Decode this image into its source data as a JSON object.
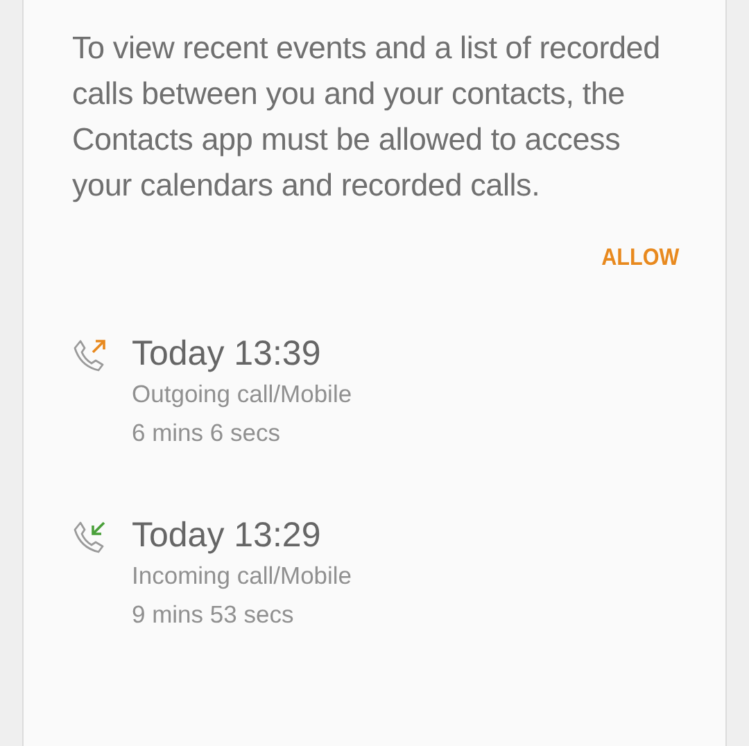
{
  "permission": {
    "message": "To view recent events and a list of recorded calls between you and your contacts, the Contacts app must be allowed to access your calendars and recorded calls.",
    "button": "ALLOW"
  },
  "calls": [
    {
      "kind": "outgoing",
      "time": "Today 13:39",
      "type": "Outgoing call/Mobile",
      "duration": "6 mins 6 secs"
    },
    {
      "kind": "incoming",
      "time": "Today 13:29",
      "type": "Incoming call/Mobile",
      "duration": "9 mins 53 secs"
    }
  ]
}
